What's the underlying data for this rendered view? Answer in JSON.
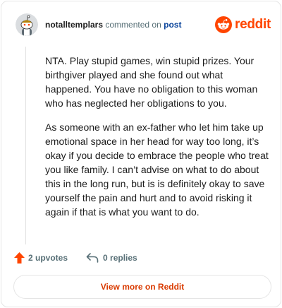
{
  "header": {
    "username": "notalltemplars",
    "action_text": "commented on",
    "post_link": "post",
    "brand_name": "reddit"
  },
  "comment": {
    "paragraphs": [
      "NTA. Play stupid games, win stupid prizes. Your birthgiver played and she found out what happened. You have no obligation to this woman who has neglected her obligations to you.",
      "As someone with an ex-father who let him take up emotional space in her head for way too long, it’s okay if you decide to embrace the people who treat you like family. I can’t advise on what to do about this in the long run, but is is definitely okay to save yourself the pain and hurt and to avoid risking it again if that is what you want to do."
    ]
  },
  "footer": {
    "upvotes": "2 upvotes",
    "replies": "0 replies",
    "view_more": "View more on Reddit"
  },
  "colors": {
    "brand": "#ff4500",
    "link": "#0a449b",
    "muted": "#576f76",
    "cta": "#d93a00"
  },
  "icons": {
    "avatar": "snoo-avatar-icon",
    "logo": "reddit-logo-icon",
    "upvote": "upvote-arrow-icon",
    "reply": "reply-arrow-icon"
  }
}
